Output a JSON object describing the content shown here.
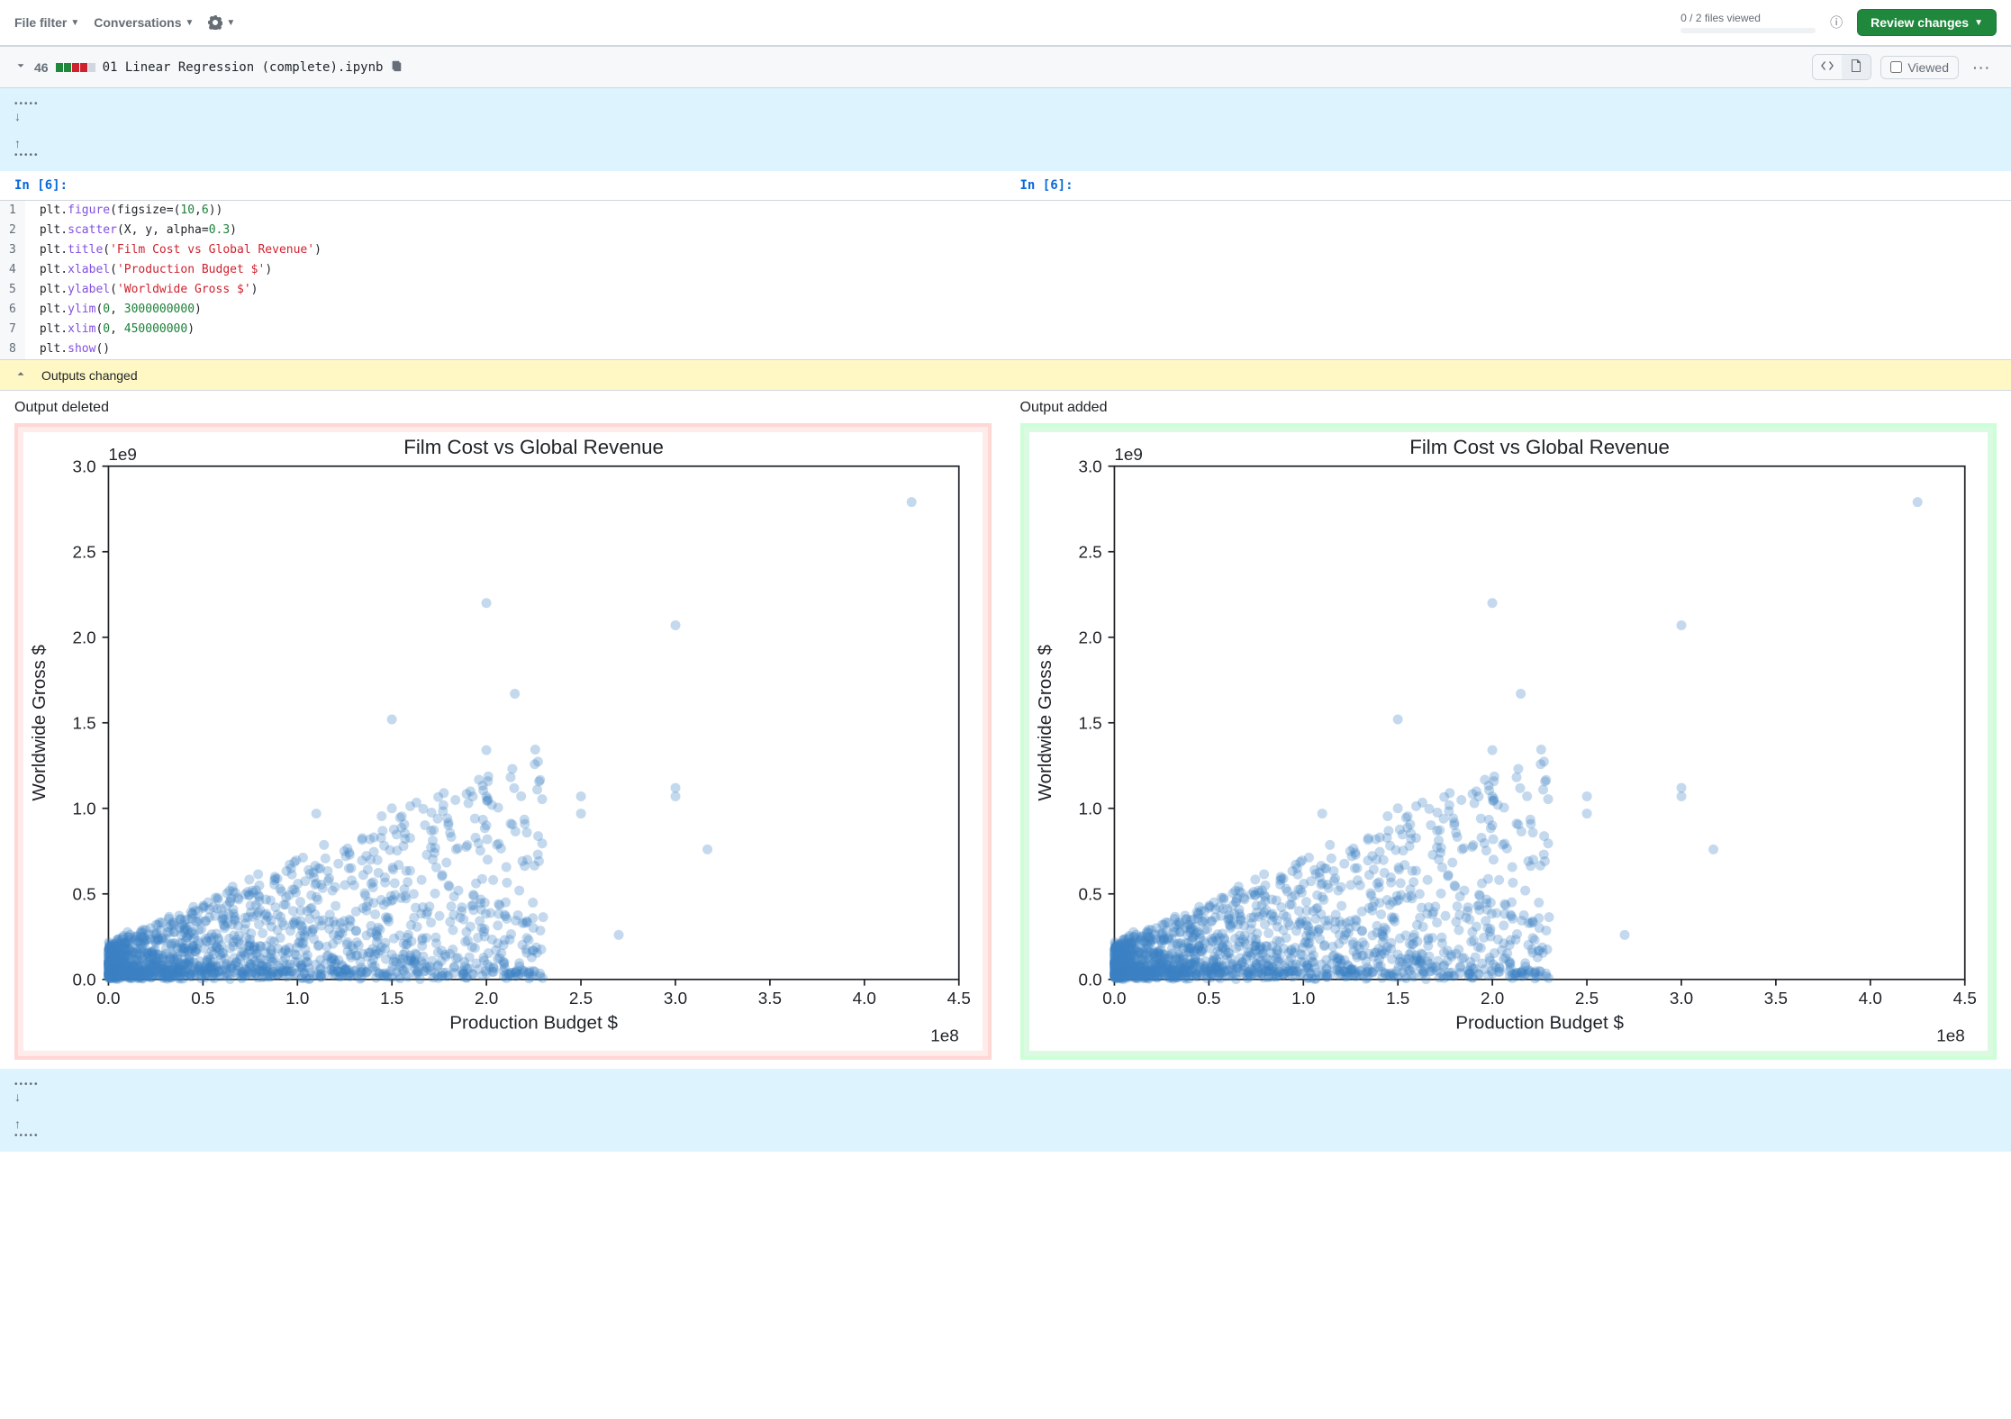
{
  "toolbar": {
    "file_filter": "File filter",
    "conversations": "Conversations",
    "files_viewed": "0 / 2 files viewed",
    "review_changes": "Review changes"
  },
  "file_header": {
    "diff_count": "46",
    "file_name": "01 Linear Regression (complete).ipynb",
    "viewed_label": "Viewed"
  },
  "cell_prompt_left": "In [6]:",
  "cell_prompt_right": "In [6]:",
  "code": {
    "line_numbers": [
      "1",
      "2",
      "3",
      "4",
      "5",
      "6",
      "7",
      "8"
    ],
    "l1a": "plt.",
    "l1b": "figure",
    "l1c": "(figsize",
    "l1d": "=",
    "l1e": "(",
    "l1f": "10",
    "l1g": ",",
    "l1h": "6",
    "l1i": "))",
    "l2a": "plt.",
    "l2b": "scatter",
    "l2c": "(X, y, alpha",
    "l2d": "=",
    "l2e": "0.3",
    "l2f": ")",
    "l3a": "plt.",
    "l3b": "title",
    "l3c": "(",
    "l3d": "'Film Cost vs Global Revenue'",
    "l3e": ")",
    "l4a": "plt.",
    "l4b": "xlabel",
    "l4c": "(",
    "l4d": "'Production Budget $'",
    "l4e": ")",
    "l5a": "plt.",
    "l5b": "ylabel",
    "l5c": "(",
    "l5d": "'Worldwide Gross $'",
    "l5e": ")",
    "l6a": "plt.",
    "l6b": "ylim",
    "l6c": "(",
    "l6d": "0",
    "l6e": ", ",
    "l6f": "3000000000",
    "l6g": ")",
    "l7a": "plt.",
    "l7b": "xlim",
    "l7c": "(",
    "l7d": "0",
    "l7e": ", ",
    "l7f": "450000000",
    "l7g": ")",
    "l8a": "plt.",
    "l8b": "show",
    "l8c": "()"
  },
  "outputs_banner": "Outputs changed",
  "output_labels": {
    "deleted": "Output deleted",
    "added": "Output added"
  },
  "chart_data": {
    "type": "scatter",
    "title": "Film Cost vs Global Revenue",
    "xlabel": "Production Budget $",
    "ylabel": "Worldwide Gross $",
    "xticks": [
      0.0,
      0.5,
      1.0,
      1.5,
      2.0,
      2.5,
      3.0,
      3.5,
      4.0,
      4.5
    ],
    "yticks": [
      0.0,
      0.5,
      1.0,
      1.5,
      2.0,
      2.5,
      3.0
    ],
    "x_exp": "1e8",
    "y_exp": "1e9",
    "xlim": [
      0,
      4.5
    ],
    "ylim": [
      0,
      3.0
    ],
    "highlights": [
      {
        "x": 4.25,
        "y": 2.79
      },
      {
        "x": 2.0,
        "y": 2.2
      },
      {
        "x": 3.0,
        "y": 2.07
      },
      {
        "x": 2.15,
        "y": 1.67
      },
      {
        "x": 1.5,
        "y": 1.52
      },
      {
        "x": 2.0,
        "y": 1.34
      },
      {
        "x": 3.0,
        "y": 1.12
      },
      {
        "x": 3.0,
        "y": 1.07
      },
      {
        "x": 2.0,
        "y": 1.07
      },
      {
        "x": 1.5,
        "y": 1.0
      },
      {
        "x": 2.5,
        "y": 1.07
      },
      {
        "x": 2.5,
        "y": 0.97
      },
      {
        "x": 2.0,
        "y": 0.9
      },
      {
        "x": 1.1,
        "y": 0.97
      },
      {
        "x": 3.17,
        "y": 0.76
      },
      {
        "x": 2.7,
        "y": 0.26
      }
    ],
    "cloud": {
      "n": 1600,
      "x_max": 2.3,
      "y_max": 0.9
    }
  }
}
